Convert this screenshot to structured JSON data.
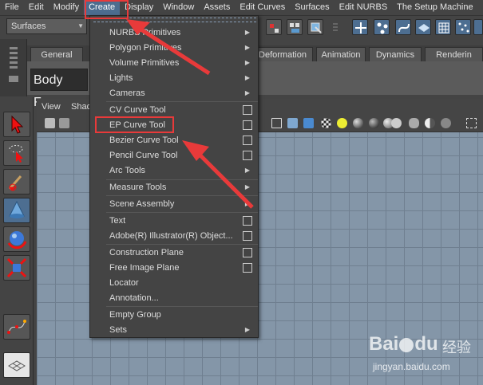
{
  "menubar": {
    "items": [
      "File",
      "Edit",
      "Modify",
      "Create",
      "Display",
      "Window",
      "Assets",
      "Edit Curves",
      "Surfaces",
      "Edit NURBS",
      "The Setup Machine"
    ],
    "active": "Create"
  },
  "mode_select": {
    "value": "Surfaces"
  },
  "shelf_tabs": [
    "General",
    "Deformation",
    "Animation",
    "Dynamics",
    "Renderin"
  ],
  "shelf": {
    "label": "Body Face"
  },
  "panel_menus": [
    "View",
    "Shad"
  ],
  "create_menu": {
    "items": [
      {
        "label": "NURBS Primitives",
        "submenu": true
      },
      {
        "label": "Polygon Primitives",
        "submenu": true
      },
      {
        "label": "Volume Primitives",
        "submenu": true
      },
      {
        "label": "Lights",
        "submenu": true
      },
      {
        "label": "Cameras",
        "submenu": true
      },
      {
        "label": "CV Curve Tool",
        "option_box": true
      },
      {
        "label": "EP Curve Tool",
        "option_box": true,
        "highlighted": true
      },
      {
        "label": "Bezier Curve Tool",
        "option_box": true
      },
      {
        "label": "Pencil Curve Tool",
        "option_box": true
      },
      {
        "label": "Arc Tools",
        "submenu": true
      },
      {
        "label": "Measure Tools",
        "submenu": true
      },
      {
        "label": "Scene Assembly",
        "submenu": true
      },
      {
        "label": "Text",
        "option_box": true
      },
      {
        "label": "Adobe(R) Illustrator(R) Object...",
        "option_box": true
      },
      {
        "label": "Construction Plane",
        "option_box": true
      },
      {
        "label": "Free Image Plane",
        "option_box": true
      },
      {
        "label": "Locator"
      },
      {
        "label": "Annotation..."
      },
      {
        "label": "Empty Group"
      },
      {
        "label": "Sets",
        "submenu": true
      }
    ]
  },
  "watermark": {
    "logo": "Bai",
    "logo_tail": "du",
    "text": "经验",
    "url": "jingyan.baidu.com"
  },
  "colors": {
    "annotation_red": "#e83a3a",
    "menu_bg": "#444444",
    "viewport_bg": "#8496a8"
  },
  "toolbox_icons": [
    "select-arrow-icon",
    "lasso-icon",
    "paint-select-icon",
    "move-cone-icon",
    "rotate-sphere-icon",
    "scale-cube-icon",
    "curve-tool-icon",
    "layout-icon"
  ]
}
